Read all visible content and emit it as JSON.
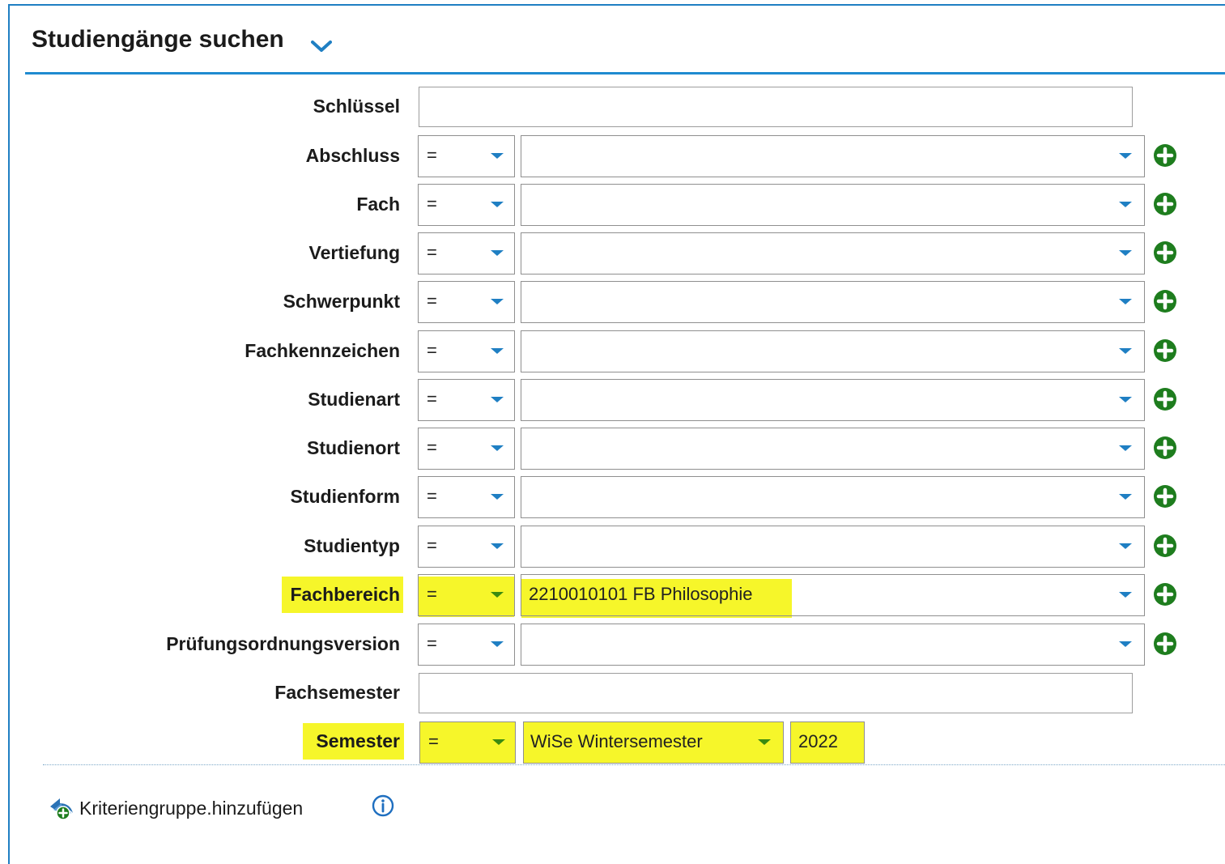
{
  "panel": {
    "title": "Studiengänge suchen"
  },
  "fields": {
    "schluessel": {
      "label": "Schlüssel",
      "value": ""
    },
    "abschluss": {
      "label": "Abschluss",
      "operator": "=",
      "value": ""
    },
    "fach": {
      "label": "Fach",
      "operator": "=",
      "value": ""
    },
    "vertiefung": {
      "label": "Vertiefung",
      "operator": "=",
      "value": ""
    },
    "schwerpunkt": {
      "label": "Schwerpunkt",
      "operator": "=",
      "value": ""
    },
    "fachkennzeichen": {
      "label": "Fachkennzeichen",
      "operator": "=",
      "value": ""
    },
    "studienart": {
      "label": "Studienart",
      "operator": "=",
      "value": ""
    },
    "studienort": {
      "label": "Studienort",
      "operator": "=",
      "value": ""
    },
    "studienform": {
      "label": "Studienform",
      "operator": "=",
      "value": ""
    },
    "studientyp": {
      "label": "Studientyp",
      "operator": "=",
      "value": ""
    },
    "fachbereich": {
      "label": "Fachbereich",
      "operator": "=",
      "value": "2210010101 FB Philosophie"
    },
    "pruefungsordnungsversion": {
      "label": "Prüfungsordnungsversion",
      "operator": "=",
      "value": ""
    },
    "fachsemester": {
      "label": "Fachsemester",
      "value": ""
    },
    "semester": {
      "label": "Semester",
      "operator": "=",
      "term": "WiSe Wintersemester",
      "year": "2022"
    }
  },
  "actions": {
    "add_group_label": "Kriteriengruppe.hinzufügen"
  },
  "colors": {
    "accent": "#1f8bd0",
    "plus_green": "#1e7d1e",
    "highlight": "#f6f62a"
  },
  "icons": {
    "title_toggle": "chevron-down-icon",
    "dropdown": "chevron-down-icon",
    "add_row": "plus-circle-icon",
    "add_group": "add-group-icon",
    "info": "info-icon"
  }
}
